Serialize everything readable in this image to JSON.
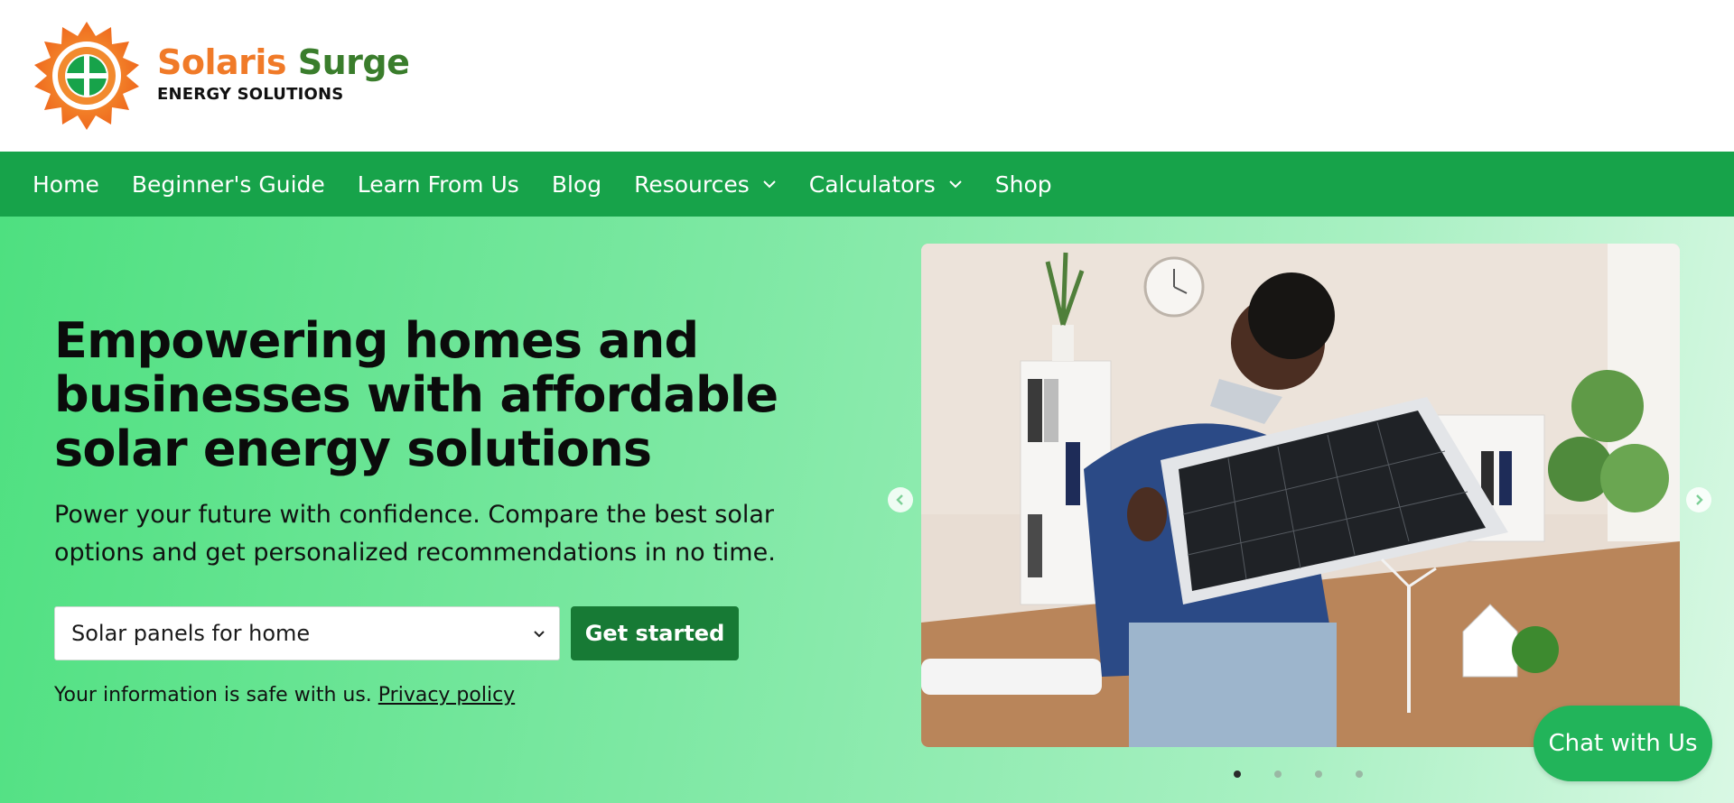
{
  "brand": {
    "name_part1": "Solaris",
    "name_part2": "Surge",
    "tagline": "ENERGY SOLUTIONS",
    "colors": {
      "orange": "#f07a28",
      "green": "#3a7d2c"
    }
  },
  "nav": {
    "items": [
      {
        "label": "Home",
        "has_dropdown": false
      },
      {
        "label": "Beginner's Guide",
        "has_dropdown": false
      },
      {
        "label": "Learn From Us",
        "has_dropdown": false
      },
      {
        "label": "Blog",
        "has_dropdown": false
      },
      {
        "label": "Resources",
        "has_dropdown": true
      },
      {
        "label": "Calculators",
        "has_dropdown": true
      },
      {
        "label": "Shop",
        "has_dropdown": false
      }
    ],
    "background": "#17a34a"
  },
  "hero": {
    "title": "Empowering homes and businesses with affordable solar energy solutions",
    "subtitle": "Power your future with confidence. Compare the best solar options and get personalized recommendations in no time.",
    "select": {
      "value": "Solar panels for home"
    },
    "cta_label": "Get started",
    "privacy_text": "Your information is safe with us.",
    "privacy_link": "Privacy policy"
  },
  "carousel": {
    "slide_count": 4,
    "active_index": 0,
    "image_subject": "man-holding-solar-panel-in-office"
  },
  "chat": {
    "label": "Chat with Us"
  }
}
